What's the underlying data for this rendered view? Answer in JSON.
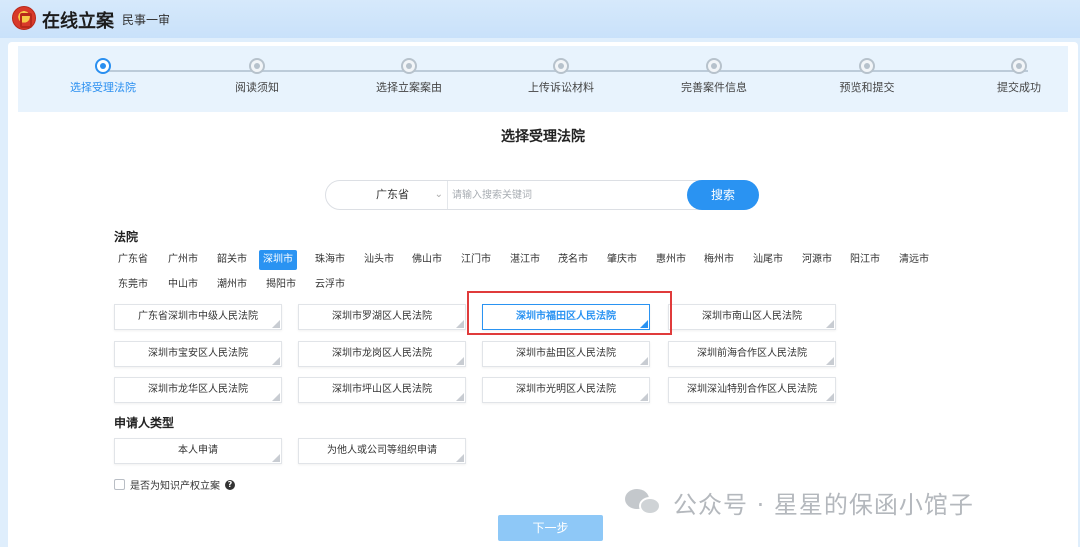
{
  "app": {
    "title": "在线立案",
    "subtitle": "民事一审"
  },
  "steps": [
    {
      "label": "选择受理法院",
      "active": true
    },
    {
      "label": "阅读须知",
      "active": false
    },
    {
      "label": "选择立案案由",
      "active": false
    },
    {
      "label": "上传诉讼材料",
      "active": false
    },
    {
      "label": "完善案件信息",
      "active": false
    },
    {
      "label": "预览和提交",
      "active": false
    },
    {
      "label": "提交成功",
      "active": false
    }
  ],
  "page_title": "选择受理法院",
  "search": {
    "province": "广东省",
    "placeholder": "请输入搜索关键词",
    "button": "搜索"
  },
  "court_section_label": "法院",
  "cities": [
    {
      "label": "广东省",
      "selected": false
    },
    {
      "label": "广州市",
      "selected": false
    },
    {
      "label": "韶关市",
      "selected": false
    },
    {
      "label": "深圳市",
      "selected": true
    },
    {
      "label": "珠海市",
      "selected": false
    },
    {
      "label": "汕头市",
      "selected": false
    },
    {
      "label": "佛山市",
      "selected": false
    },
    {
      "label": "江门市",
      "selected": false
    },
    {
      "label": "湛江市",
      "selected": false
    },
    {
      "label": "茂名市",
      "selected": false
    },
    {
      "label": "肇庆市",
      "selected": false
    },
    {
      "label": "惠州市",
      "selected": false
    },
    {
      "label": "梅州市",
      "selected": false
    },
    {
      "label": "汕尾市",
      "selected": false
    },
    {
      "label": "河源市",
      "selected": false
    },
    {
      "label": "阳江市",
      "selected": false
    },
    {
      "label": "清远市",
      "selected": false
    },
    {
      "label": "东莞市",
      "selected": false
    },
    {
      "label": "中山市",
      "selected": false
    },
    {
      "label": "潮州市",
      "selected": false
    },
    {
      "label": "揭阳市",
      "selected": false
    },
    {
      "label": "云浮市",
      "selected": false
    }
  ],
  "courts": [
    {
      "label": "广东省深圳市中级人民法院",
      "selected": false
    },
    {
      "label": "深圳市罗湖区人民法院",
      "selected": false
    },
    {
      "label": "深圳市福田区人民法院",
      "selected": true
    },
    {
      "label": "深圳市南山区人民法院",
      "selected": false
    },
    {
      "label": "深圳市宝安区人民法院",
      "selected": false
    },
    {
      "label": "深圳市龙岗区人民法院",
      "selected": false
    },
    {
      "label": "深圳市盐田区人民法院",
      "selected": false
    },
    {
      "label": "深圳前海合作区人民法院",
      "selected": false
    },
    {
      "label": "深圳市龙华区人民法院",
      "selected": false
    },
    {
      "label": "深圳市坪山区人民法院",
      "selected": false
    },
    {
      "label": "深圳市光明区人民法院",
      "selected": false
    },
    {
      "label": "深圳深汕特别合作区人民法院",
      "selected": false
    }
  ],
  "applicant_section_label": "申请人类型",
  "applicant_types": [
    {
      "label": "本人申请"
    },
    {
      "label": "为他人或公司等组织申请"
    }
  ],
  "ip_checkbox_label": "是否为知识产权立案",
  "next_button": "下一步",
  "watermark": "公众号 · 星星的保函小馆子",
  "colors": {
    "accent": "#2a93f2",
    "highlight": "#e03b3b",
    "next_disabled": "#8ec8f7"
  }
}
